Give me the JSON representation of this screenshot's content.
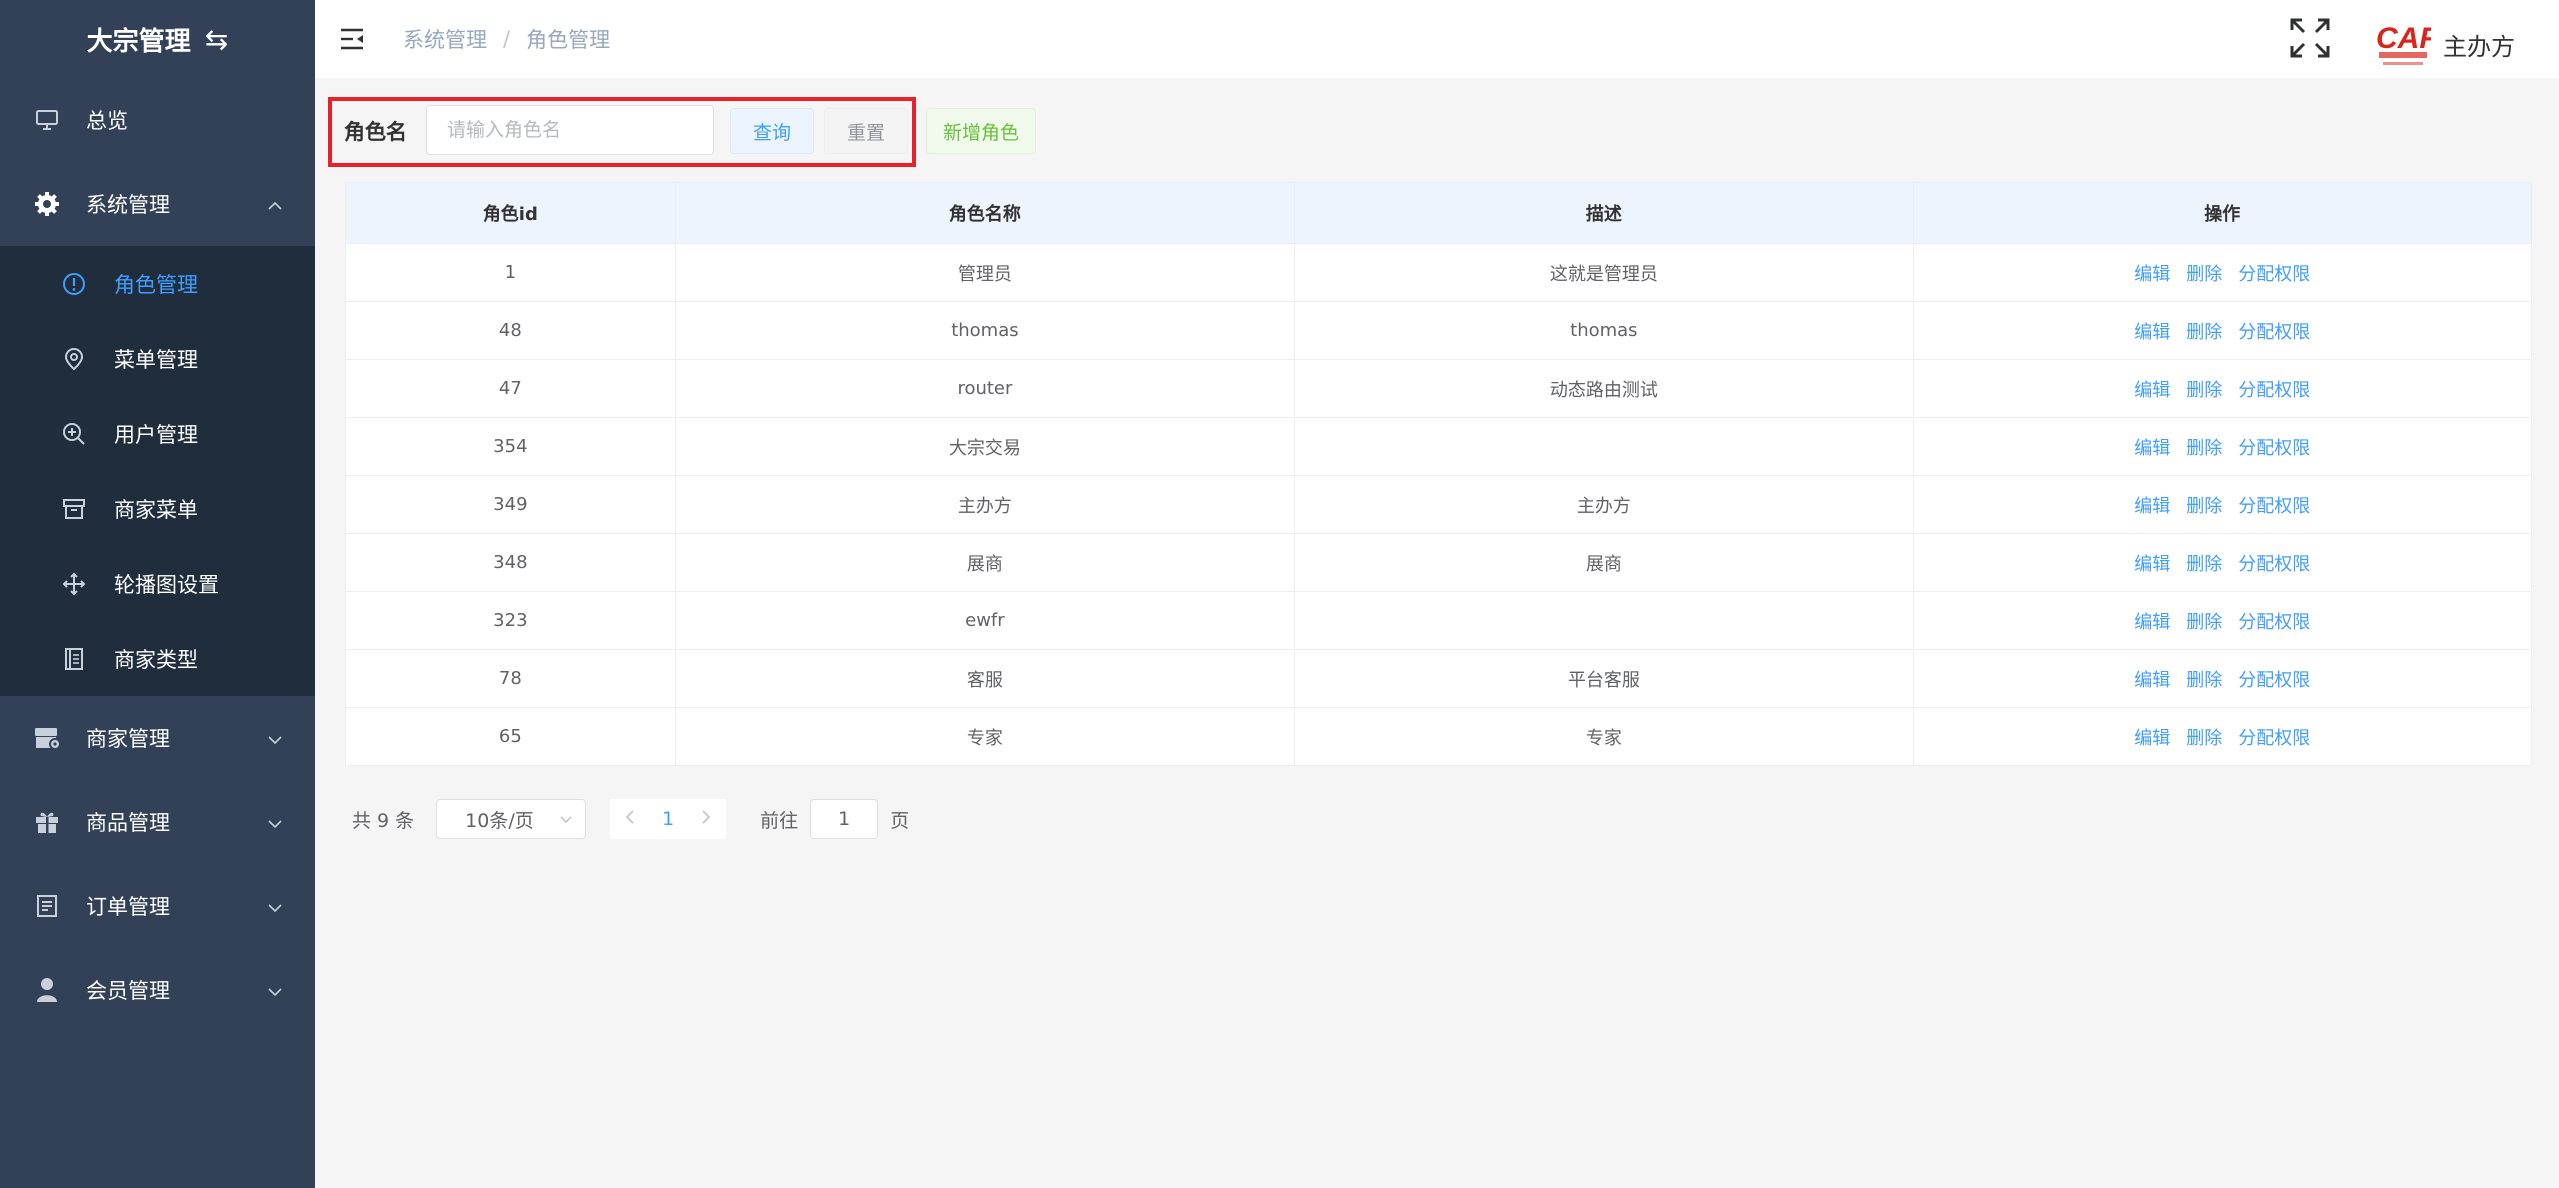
{
  "sidebar": {
    "brand": "大宗管理",
    "items": [
      {
        "label": "总览",
        "icon": "monitor-icon"
      },
      {
        "label": "系统管理",
        "icon": "gear-icon",
        "expanded": true,
        "children": [
          {
            "label": "角色管理",
            "icon": "info-circle-icon",
            "active": true
          },
          {
            "label": "菜单管理",
            "icon": "location-pin-icon"
          },
          {
            "label": "用户管理",
            "icon": "zoom-in-icon"
          },
          {
            "label": "商家菜单",
            "icon": "box-icon"
          },
          {
            "label": "轮播图设置",
            "icon": "move-icon"
          },
          {
            "label": "商家类型",
            "icon": "document-icon"
          }
        ]
      },
      {
        "label": "商家管理",
        "icon": "store-icon"
      },
      {
        "label": "商品管理",
        "icon": "gift-icon"
      },
      {
        "label": "订单管理",
        "icon": "order-icon"
      },
      {
        "label": "会员管理",
        "icon": "user-icon"
      }
    ]
  },
  "header": {
    "breadcrumb": [
      "系统管理",
      "角色管理"
    ],
    "user": "主办方",
    "logo_text": "CAF"
  },
  "filter": {
    "label": "角色名",
    "placeholder": "请输入角色名",
    "query_label": "查询",
    "reset_label": "重置",
    "add_label": "新增角色"
  },
  "table": {
    "columns": [
      "角色id",
      "角色名称",
      "描述",
      "操作"
    ],
    "rows": [
      {
        "id": "1",
        "name": "管理员",
        "desc": "这就是管理员"
      },
      {
        "id": "48",
        "name": "thomas",
        "desc": "thomas"
      },
      {
        "id": "47",
        "name": "router",
        "desc": "动态路由测试"
      },
      {
        "id": "354",
        "name": "大宗交易",
        "desc": ""
      },
      {
        "id": "349",
        "name": "主办方",
        "desc": "主办方"
      },
      {
        "id": "348",
        "name": "展商",
        "desc": "展商"
      },
      {
        "id": "323",
        "name": "ewfr",
        "desc": ""
      },
      {
        "id": "78",
        "name": "客服",
        "desc": "平台客服"
      },
      {
        "id": "65",
        "name": "专家",
        "desc": "专家"
      }
    ],
    "actions": {
      "edit": "编辑",
      "delete": "删除",
      "assign": "分配权限"
    }
  },
  "pagination": {
    "total": "共 9 条",
    "page_size": "10条/页",
    "current_page": "1",
    "goto_label": "前往",
    "goto_value": "1",
    "page_suffix": "页"
  },
  "colors": {
    "sidebar_bg": "#324157",
    "submenu_bg": "#1f2d3d",
    "accent": "#409eff",
    "highlight_border": "#e8212a"
  }
}
